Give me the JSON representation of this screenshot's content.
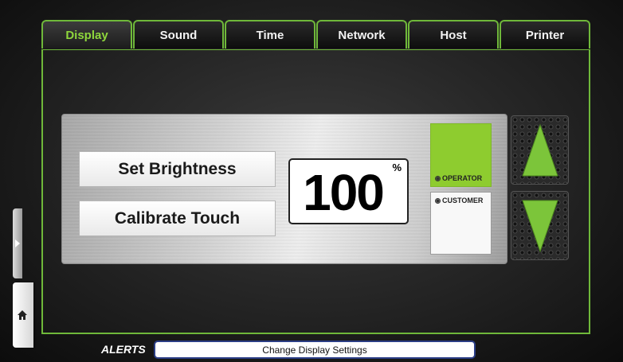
{
  "tabs": [
    {
      "label": "Display",
      "active": true
    },
    {
      "label": "Sound",
      "active": false
    },
    {
      "label": "Time",
      "active": false
    },
    {
      "label": "Network",
      "active": false
    },
    {
      "label": "Host",
      "active": false
    },
    {
      "label": "Printer",
      "active": false
    }
  ],
  "display_panel": {
    "set_brightness_label": "Set Brightness",
    "calibrate_touch_label": "Calibrate Touch",
    "brightness_value": "100",
    "brightness_unit": "%",
    "modes": [
      {
        "label": "OPERATOR",
        "selected": true
      },
      {
        "label": "CUSTOMER",
        "selected": false
      }
    ],
    "increase_icon": "arrow-up-icon",
    "decrease_icon": "arrow-down-icon"
  },
  "side_nav": {
    "expand_icon": "chevron-right-icon",
    "home_icon": "home-icon"
  },
  "alerts": {
    "label": "ALERTS",
    "message": "Change Display Settings"
  },
  "colors": {
    "accent": "#6fb83a",
    "active_tab_text": "#8ed63c",
    "operator_fill": "#8ecc2f",
    "arrow_fill": "#7cc53a",
    "alert_border": "#2b3e86"
  }
}
